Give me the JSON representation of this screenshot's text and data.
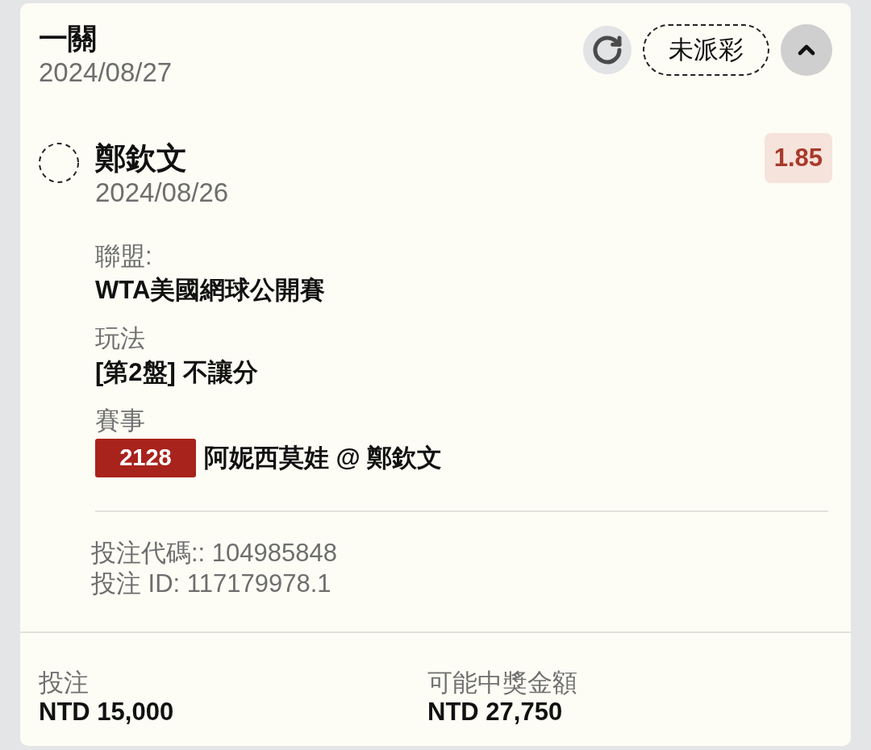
{
  "bet": {
    "title": "一關",
    "date": "2024/08/27",
    "status": "未派彩",
    "expanded": true
  },
  "selection": {
    "pending": true,
    "name": "鄭欽文",
    "date": "2024/08/26",
    "odds": "1.85"
  },
  "details": [
    {
      "label": "聯盟:",
      "value": "WTA美國網球公開賽"
    },
    {
      "label": "玩法",
      "value": "[第2盤] 不讓分"
    },
    {
      "label": "賽事",
      "code": "2128",
      "value": "阿妮西莫娃 @ 鄭欽文"
    }
  ],
  "references": [
    "投注代碼:: 104985848",
    "投注 ID: 117179978.1"
  ],
  "summary": [
    {
      "label": "投注",
      "value": "NTD 15,000"
    },
    {
      "label": "可能中獎金額",
      "value": "NTD 27,750"
    }
  ]
}
